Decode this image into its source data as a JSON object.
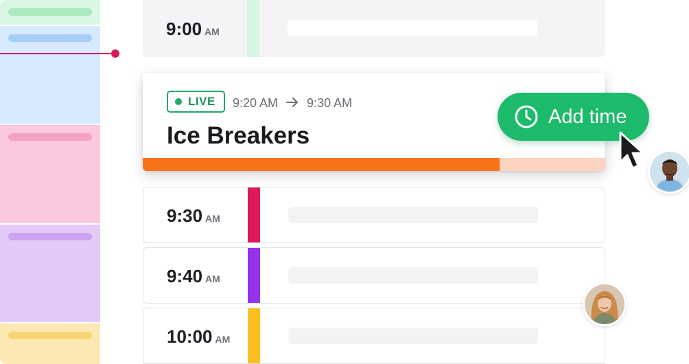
{
  "rail": {
    "colors": [
      "#daf6e4",
      "#d6e9ff",
      "#fbc8df",
      "#e3c9f7",
      "#fde8b4"
    ]
  },
  "agenda": {
    "rows": [
      {
        "time": "9:00",
        "ampm": "AM",
        "color": "#d6f5e0"
      },
      {
        "time": "9:30",
        "ampm": "AM",
        "color": "#dc1a5a"
      },
      {
        "time": "9:40",
        "ampm": "AM",
        "color": "#9333ea"
      },
      {
        "time": "10:00",
        "ampm": "AM",
        "color": "#fbbf24"
      }
    ]
  },
  "live_event": {
    "badge": "LIVE",
    "start": "9:20 AM",
    "end": "9:30 AM",
    "title": "Ice Breakers",
    "progress": 0.772,
    "progress_color": "#f97316",
    "accent": "#1fa866"
  },
  "actions": {
    "add_time_label": "Add time",
    "add_time_icon": "clock-icon",
    "button_color": "#1eba6c"
  }
}
